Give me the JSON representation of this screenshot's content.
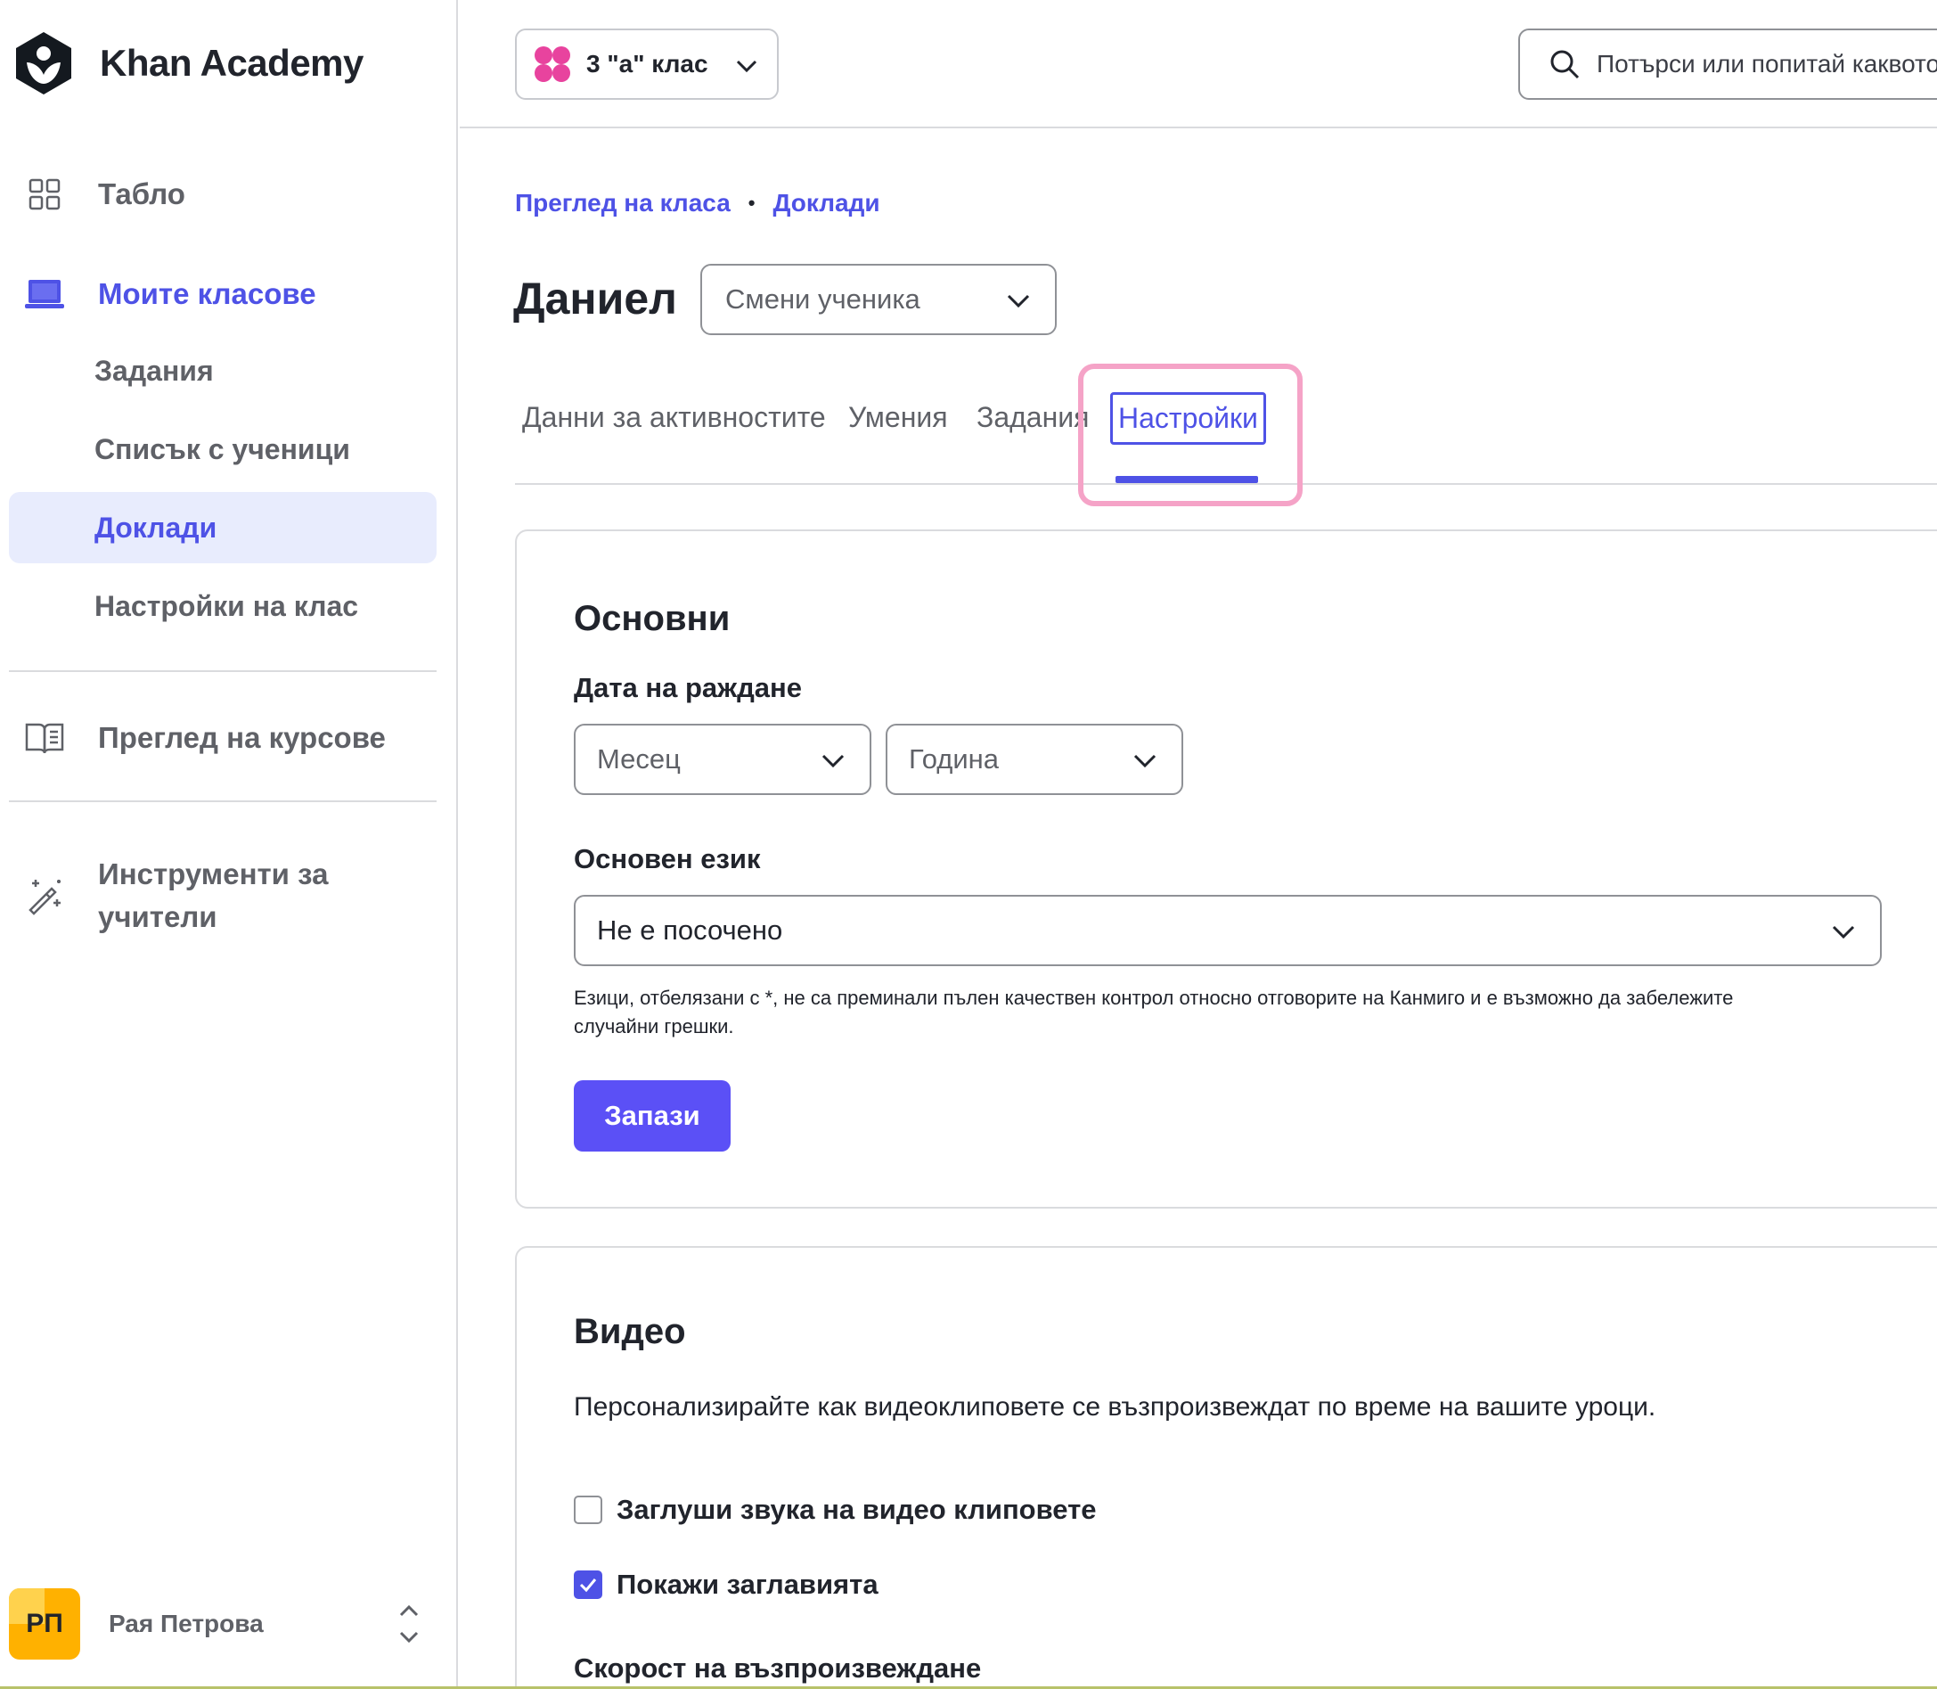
{
  "brand": {
    "name": "Khan Academy"
  },
  "sidebar": {
    "dashboard": "Табло",
    "my_classes": "Моите класове",
    "sub_items": {
      "assignments": "Задания",
      "roster": "Списък с ученици",
      "reports": "Доклади",
      "class_settings": "Настройки на клас"
    },
    "browse_courses": "Преглед на курсове",
    "teacher_tools": "Инструменти за учители",
    "user": {
      "initials": "РП",
      "name": "Рая Петрова"
    }
  },
  "topbar": {
    "class_name": "3 \"а\" клас",
    "search_placeholder": "Потърси или попитай каквото и"
  },
  "breadcrumb": {
    "overview": "Преглед на класа",
    "separator": "•",
    "reports": "Доклади"
  },
  "student": {
    "name": "Даниел",
    "switch_placeholder": "Смени ученика"
  },
  "tabs": {
    "activity": "Данни за активностите",
    "skills": "Умения",
    "assignments": "Задания",
    "settings": "Настройки",
    "active": "settings"
  },
  "basics": {
    "title": "Основни",
    "birth_label": "Дата на раждане",
    "month_placeholder": "Месец",
    "year_placeholder": "Година",
    "language_label": "Основен език",
    "language_value": "Не е посочено",
    "language_note": "Езици, отбелязани с *, не са преминали пълен качествен контрол относно отговорите на Канмиго и е възможно да забележите случайни грешки.",
    "save": "Запази"
  },
  "video": {
    "title": "Видео",
    "description": "Персонализирайте как видеоклиповете се възпроизвеждат по време на вашите уроци.",
    "mute_label": "Заглуши звука на видео клиповете",
    "mute_checked": false,
    "captions_label": "Покажи заглавията",
    "captions_checked": true,
    "speed_label": "Скорост на възпроизвеждане"
  },
  "colors": {
    "accent": "#4e52e6",
    "button": "#5b50f6",
    "highlight": "#f5a3c7",
    "avatar": "#ffb100",
    "active_bg": "#e8ecfd"
  }
}
